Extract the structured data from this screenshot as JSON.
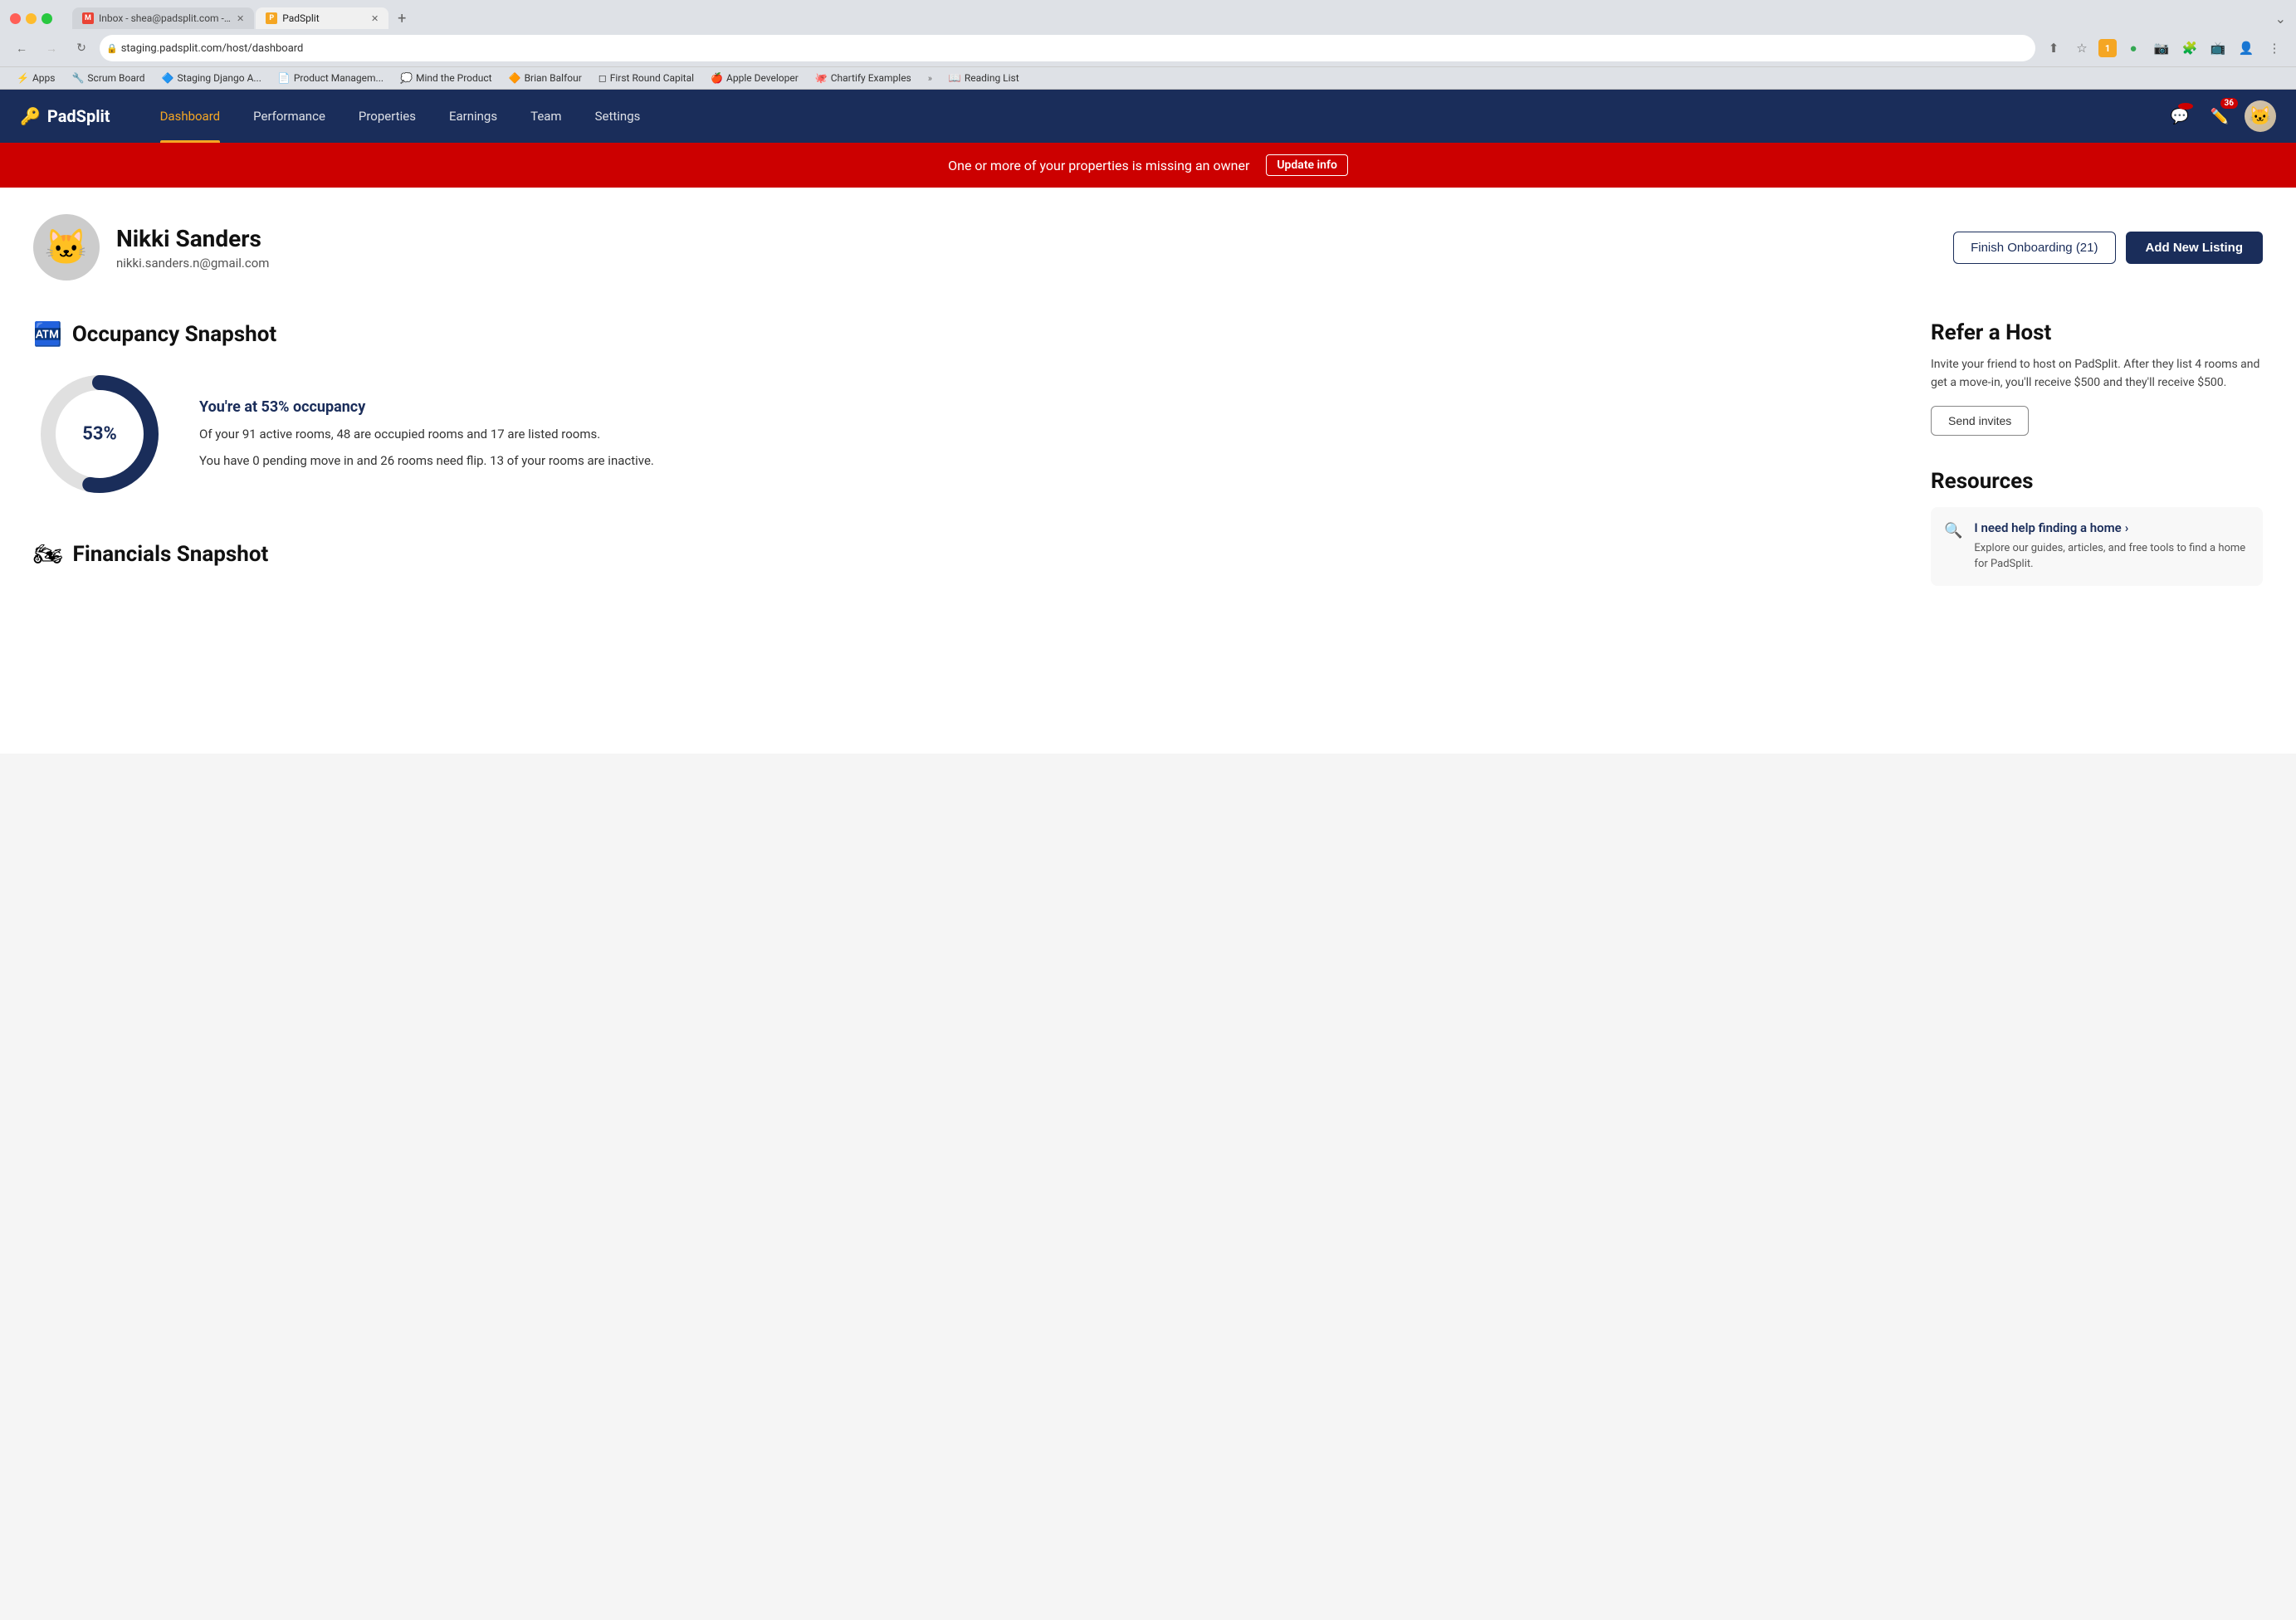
{
  "browser": {
    "tabs": [
      {
        "id": "tab-gmail",
        "label": "Inbox - shea@padsplit.com - P...",
        "favicon_color": "#EA4335",
        "favicon_letter": "M",
        "active": false
      },
      {
        "id": "tab-padsplit",
        "label": "PadSplit",
        "favicon_color": "#f5a623",
        "favicon_letter": "P",
        "active": true
      }
    ],
    "address": "staging.padsplit.com/host/dashboard",
    "bookmarks": [
      {
        "id": "bm-apps",
        "label": "Apps",
        "icon": "⚡"
      },
      {
        "id": "bm-scrum",
        "label": "Scrum Board",
        "icon": "🔧"
      },
      {
        "id": "bm-staging",
        "label": "Staging Django A...",
        "icon": "🔷"
      },
      {
        "id": "bm-product",
        "label": "Product Managem...",
        "icon": "📄"
      },
      {
        "id": "bm-mind",
        "label": "Mind the Product",
        "icon": "💭"
      },
      {
        "id": "bm-brian",
        "label": "Brian Balfour",
        "icon": "🔶"
      },
      {
        "id": "bm-first",
        "label": "First Round Capital",
        "icon": "◻"
      },
      {
        "id": "bm-apple",
        "label": "Apple Developer",
        "icon": "🍎"
      },
      {
        "id": "bm-chartify",
        "label": "Chartify Examples",
        "icon": "🐙"
      }
    ]
  },
  "nav": {
    "logo_text": "PadSplit",
    "links": [
      {
        "id": "nav-dashboard",
        "label": "Dashboard",
        "active": true
      },
      {
        "id": "nav-performance",
        "label": "Performance",
        "active": false
      },
      {
        "id": "nav-properties",
        "label": "Properties",
        "active": false
      },
      {
        "id": "nav-earnings",
        "label": "Earnings",
        "active": false
      },
      {
        "id": "nav-team",
        "label": "Team",
        "active": false
      },
      {
        "id": "nav-settings",
        "label": "Settings",
        "active": false
      }
    ],
    "notification_badge": "",
    "edit_badge": "36"
  },
  "alert": {
    "message": "One or more of your properties is missing an owner",
    "cta_label": "Update info"
  },
  "profile": {
    "name": "Nikki Sanders",
    "email": "nikki.sanders.n@gmail.com",
    "finish_onboarding_label": "Finish Onboarding (21)",
    "add_listing_label": "Add New Listing"
  },
  "occupancy": {
    "section_title": "Occupancy Snapshot",
    "section_icon": "🏧",
    "headline": "You're at 53% occupancy",
    "percent": 53,
    "detail_line1": "Of your 91 active rooms, 48 are occupied rooms and 17 are listed rooms.",
    "detail_line2": "You have 0 pending move in and 26 rooms need flip. 13 of your rooms are inactive.",
    "center_label": "53%"
  },
  "financials": {
    "section_title": "Financials Snapshot",
    "section_icon": "🏍"
  },
  "refer": {
    "title": "Refer a Host",
    "description": "Invite your friend to host on PadSplit. After they list 4 rooms and get a move-in, you'll receive $500 and they'll receive $500.",
    "cta_label": "Send invites"
  },
  "resources": {
    "title": "Resources",
    "items": [
      {
        "id": "resource-find-home",
        "link_text": "I need help finding a home",
        "description": "Explore our guides, articles, and free tools to find a home for PadSplit."
      }
    ]
  }
}
